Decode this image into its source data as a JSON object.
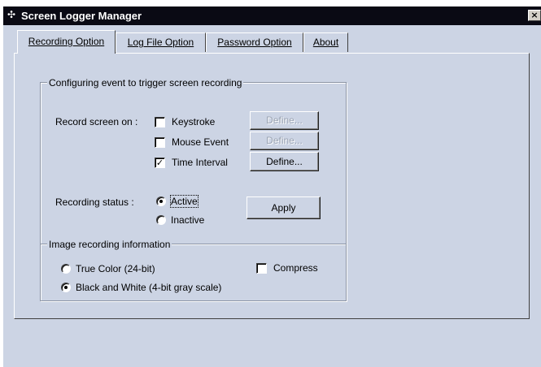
{
  "window": {
    "title": "Screen Logger Manager",
    "title_icon": "app-icon",
    "close_glyph": "×"
  },
  "tabs": [
    {
      "label": "Recording Option",
      "active": true
    },
    {
      "label": "Log File Option",
      "active": false
    },
    {
      "label": "Password Option",
      "active": false
    },
    {
      "label": "About",
      "active": false
    }
  ],
  "trigger_group": {
    "legend": "Configuring event to trigger screen recording",
    "record_screen_on_label": "Record screen on  :",
    "events": [
      {
        "label": "Keystroke",
        "checked": false,
        "define_label": "Define...",
        "define_enabled": false
      },
      {
        "label": "Mouse Event",
        "checked": false,
        "define_label": "Define...",
        "define_enabled": false
      },
      {
        "label": "Time Interval",
        "checked": true,
        "define_label": "Define...",
        "define_enabled": true
      }
    ],
    "recording_status_label": "Recording status :",
    "status_options": [
      {
        "label": "Active",
        "selected": true
      },
      {
        "label": "Inactive",
        "selected": false
      }
    ],
    "apply_label": "Apply"
  },
  "image_group": {
    "legend": "Image recording information",
    "color_options": [
      {
        "label": "True Color (24-bit)",
        "selected": false
      },
      {
        "label": "Black and White (4-bit gray scale)",
        "selected": true
      }
    ],
    "compress_label": "Compress",
    "compress_checked": false
  },
  "colors": {
    "titlebar": "#0a0a14",
    "window_bg": "#ccd4e4"
  }
}
